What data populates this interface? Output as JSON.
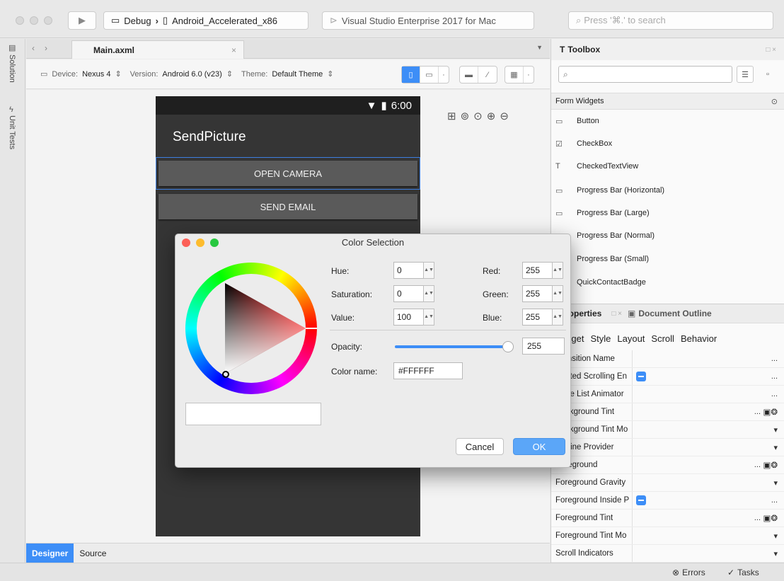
{
  "toolbar": {
    "config_label": "Debug",
    "device_label": "Android_Accelerated_x86",
    "status_text": "Visual Studio Enterprise 2017 for Mac",
    "search_placeholder": "Press '⌘.' to search"
  },
  "sidebar": {
    "solution_label": "Solution",
    "unit_tests_label": "Unit Tests"
  },
  "document": {
    "tab_name": "Main.axml"
  },
  "designer": {
    "device_label": "Device:",
    "device_value": "Nexus 4",
    "version_label": "Version:",
    "version_value": "Android 6.0 (v23)",
    "theme_label": "Theme:",
    "theme_value": "Default Theme"
  },
  "phone": {
    "clock": "6:00",
    "app_title": "SendPicture",
    "button1": "OPEN CAMERA",
    "button2": "SEND EMAIL"
  },
  "bottom_tabs": {
    "designer": "Designer",
    "source": "Source"
  },
  "toolbox": {
    "title": "Toolbox",
    "section": "Form Widgets",
    "items": [
      {
        "icon": "button-icon",
        "label": "Button"
      },
      {
        "icon": "checkbox-icon",
        "label": "CheckBox"
      },
      {
        "icon": "text-icon",
        "label": "CheckedTextView"
      },
      {
        "icon": "progress-icon",
        "label": "Progress Bar (Horizontal)"
      },
      {
        "icon": "progress-icon",
        "label": "Progress Bar (Large)"
      },
      {
        "icon": "progress-icon",
        "label": "Progress Bar (Normal)"
      },
      {
        "icon": "progress-icon",
        "label": "Progress Bar (Small)"
      },
      {
        "icon": "badge-icon",
        "label": "QuickContactBadge"
      }
    ]
  },
  "properties": {
    "title": "Properties",
    "outline_tab": "Document Outline",
    "tabs": [
      "Widget",
      "Style",
      "Layout",
      "Scroll",
      "Behavior"
    ],
    "rows": [
      {
        "name": "Transition Name",
        "value": "..."
      },
      {
        "name": "Nested Scrolling En",
        "value": "..."
      },
      {
        "name": "State List Animator",
        "value": "..."
      },
      {
        "name": "Background Tint",
        "value": "..."
      },
      {
        "name": "Background Tint Mo",
        "value": "▾"
      },
      {
        "name": "Outline Provider",
        "value": "▾"
      },
      {
        "name": "Foreground",
        "value": "..."
      },
      {
        "name": "Foreground Gravity",
        "value": "▾"
      },
      {
        "name": "Foreground Inside P",
        "value": "..."
      },
      {
        "name": "Foreground Tint",
        "value": "..."
      },
      {
        "name": "Foreground Tint Mo",
        "value": "▾"
      },
      {
        "name": "Scroll Indicators",
        "value": "▾"
      }
    ]
  },
  "statusbar": {
    "errors": "Errors",
    "tasks": "Tasks"
  },
  "color_dialog": {
    "title": "Color Selection",
    "hue_label": "Hue:",
    "hue": "0",
    "saturation_label": "Saturation:",
    "saturation": "0",
    "value_label": "Value:",
    "value": "100",
    "red_label": "Red:",
    "red": "255",
    "green_label": "Green:",
    "green": "255",
    "blue_label": "Blue:",
    "blue": "255",
    "opacity_label": "Opacity:",
    "opacity": "255",
    "opacity_fraction": 1.0,
    "color_name_label": "Color name:",
    "color_name": "#FFFFFF",
    "cancel": "Cancel",
    "ok": "OK"
  },
  "colors": {
    "accent": "#3d8ef7",
    "phone_bg": "#353535"
  }
}
